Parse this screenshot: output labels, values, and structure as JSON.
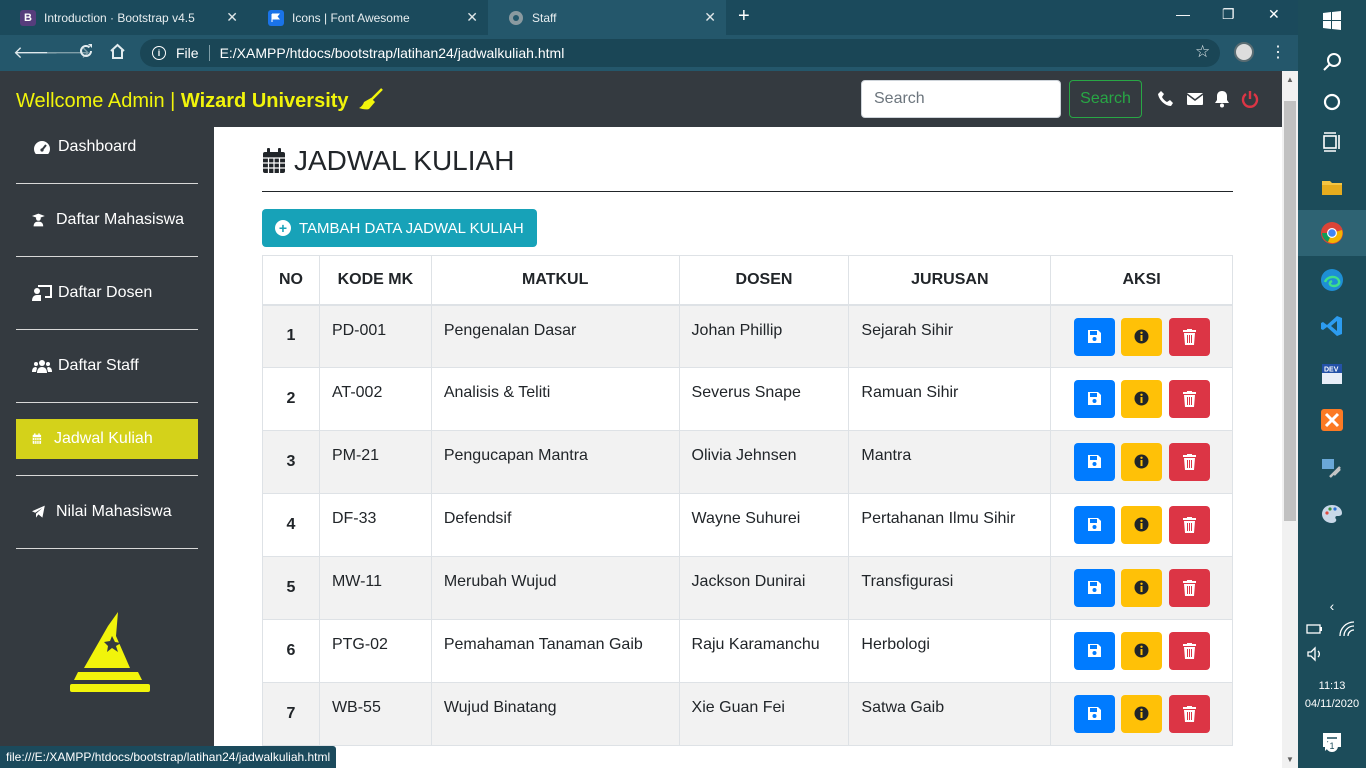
{
  "browser": {
    "tabs": [
      {
        "title": "Introduction · Bootstrap v4.5",
        "favicon": "B",
        "color": "#563d7c"
      },
      {
        "title": "Icons | Font Awesome",
        "favicon": "flag",
        "color": "#1a73e8"
      },
      {
        "title": "Staff",
        "favicon": "globe",
        "color": "#7a8a90"
      }
    ],
    "address_scheme": "File",
    "address": "E:/XAMPP/htdocs/bootstrap/latihan24/jadwalkuliah.html",
    "status_url": "file:///E:/XAMPP/htdocs/bootstrap/latihan24/jadwalkuliah.html"
  },
  "navbar": {
    "brand_prefix": "Wellcome Admin | ",
    "brand_name": "Wizard University",
    "search_placeholder": "Search",
    "search_button": "Search",
    "icons": [
      "phone-icon",
      "envelope-icon",
      "bell-icon",
      "power-icon"
    ],
    "accent": "#f1f40b"
  },
  "sidebar": {
    "items": [
      {
        "label": "Dashboard",
        "icon": "tachometer-icon"
      },
      {
        "label": "Daftar Mahasiswa",
        "icon": "user-graduate-icon"
      },
      {
        "label": "Daftar Dosen",
        "icon": "chalkboard-teacher-icon"
      },
      {
        "label": "Daftar Staff",
        "icon": "users-icon"
      },
      {
        "label": "Jadwal Kuliah",
        "icon": "calendar-icon",
        "active": true
      },
      {
        "label": "Nilai Mahasiswa",
        "icon": "paper-plane-icon"
      }
    ],
    "active_color": "#d4d21a"
  },
  "main": {
    "title": "JADWAL KULIAH",
    "add_button": "TAMBAH DATA JADWAL KULIAH",
    "table": {
      "headers": [
        "NO",
        "KODE MK",
        "MATKUL",
        "DOSEN",
        "JURUSAN",
        "AKSI"
      ],
      "rows": [
        {
          "no": "1",
          "kode": "PD-001",
          "matkul": "Pengenalan Dasar",
          "dosen": "Johan Phillip",
          "jurusan": "Sejarah Sihir"
        },
        {
          "no": "2",
          "kode": "AT-002",
          "matkul": "Analisis & Teliti",
          "dosen": "Severus Snape",
          "jurusan": "Ramuan Sihir"
        },
        {
          "no": "3",
          "kode": "PM-21",
          "matkul": "Pengucapan Mantra",
          "dosen": "Olivia Jehnsen",
          "jurusan": "Mantra"
        },
        {
          "no": "4",
          "kode": "DF-33",
          "matkul": "Defendsif",
          "dosen": "Wayne Suhurei",
          "jurusan": "Pertahanan Ilmu Sihir"
        },
        {
          "no": "5",
          "kode": "MW-11",
          "matkul": "Merubah Wujud",
          "dosen": "Jackson Dunirai",
          "jurusan": "Transfigurasi"
        },
        {
          "no": "6",
          "kode": "PTG-02",
          "matkul": "Pemahaman Tanaman Gaib",
          "dosen": "Raju Karamanchu",
          "jurusan": "Herbologi"
        },
        {
          "no": "7",
          "kode": "WB-55",
          "matkul": "Wujud Binatang",
          "dosen": "Xie Guan Fei",
          "jurusan": "Satwa Gaib"
        }
      ]
    },
    "action_colors": {
      "save": "#007bff",
      "info": "#ffc107",
      "delete": "#dc3545"
    }
  },
  "taskbar": {
    "time": "11:13",
    "date": "04/11/2020",
    "notification_count": "1"
  }
}
